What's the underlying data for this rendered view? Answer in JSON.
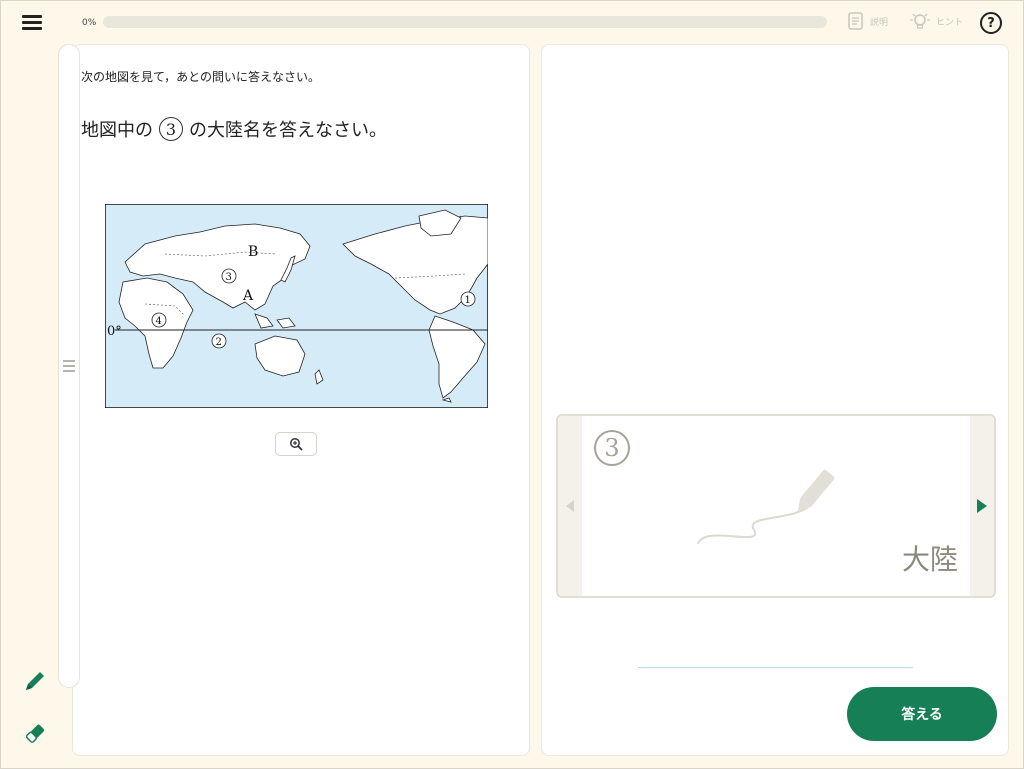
{
  "header": {
    "progress_label": "0%",
    "progress_value": 0,
    "explain_label": "説明",
    "hint_label": "ヒント",
    "help_label": "?"
  },
  "question": {
    "instruction": "次の地図を見て，あとの問いに答えなさい。",
    "prefix": "地図中の",
    "number": "3",
    "suffix": "の大陸名を答えなさい。"
  },
  "map": {
    "labels": {
      "B": "B",
      "A": "A",
      "num1": "1",
      "num2": "2",
      "num3": "3",
      "num4": "4",
      "equator": "0°"
    }
  },
  "answer": {
    "card_number": "3",
    "suffix": "大陸",
    "value": "",
    "submit_label": "答える"
  },
  "colors": {
    "accent": "#177f55",
    "background": "#fdf8ea",
    "map_ocean": "#d5ecf8"
  }
}
